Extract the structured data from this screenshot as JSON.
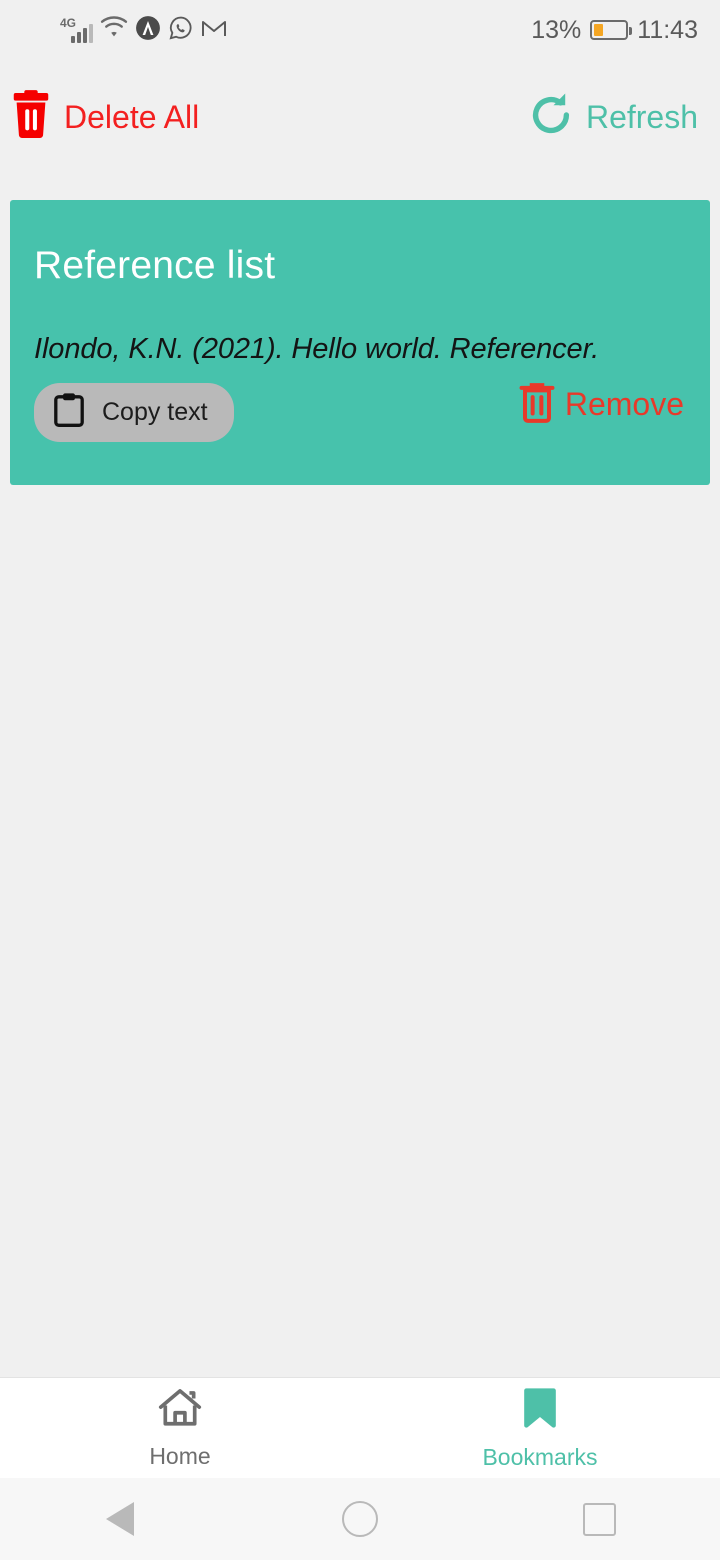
{
  "status_bar": {
    "network_label": "4G",
    "signal_icon": "signal-bars-icon",
    "wifi_icon": "wifi-icon",
    "app_icon": "circle-a-app-icon",
    "whatsapp_icon": "whatsapp-icon",
    "gmail_icon": "gmail-icon",
    "battery_percent": "13%",
    "battery_level": 0.28,
    "battery_color": "#f5a623",
    "time": "11:43"
  },
  "toolbar": {
    "delete_all_label": "Delete All",
    "delete_all_icon": "trash-filled-icon",
    "delete_all_color": "#f32020",
    "refresh_label": "Refresh",
    "refresh_icon": "refresh-icon",
    "refresh_color": "#4ec0a8"
  },
  "card": {
    "title": "Reference list",
    "background_color": "#47c2ac",
    "reference": {
      "text": "Ilondo, K.N. (2021). Hello world. Referencer.",
      "copy_label": "Copy text",
      "copy_icon": "clipboard-icon",
      "remove_label": "Remove",
      "remove_icon": "trash-outline-icon",
      "remove_color": "#e8392a"
    }
  },
  "bottom_nav": {
    "items": [
      {
        "label": "Home",
        "icon": "home-icon",
        "active": false
      },
      {
        "label": "Bookmarks",
        "icon": "bookmark-icon",
        "active": true
      }
    ],
    "active_color": "#4ec0a8",
    "inactive_color": "#6e6e6e"
  },
  "system_nav": {
    "back_icon": "back-triangle-icon",
    "home_icon": "home-circle-icon",
    "recents_icon": "recents-square-icon"
  }
}
